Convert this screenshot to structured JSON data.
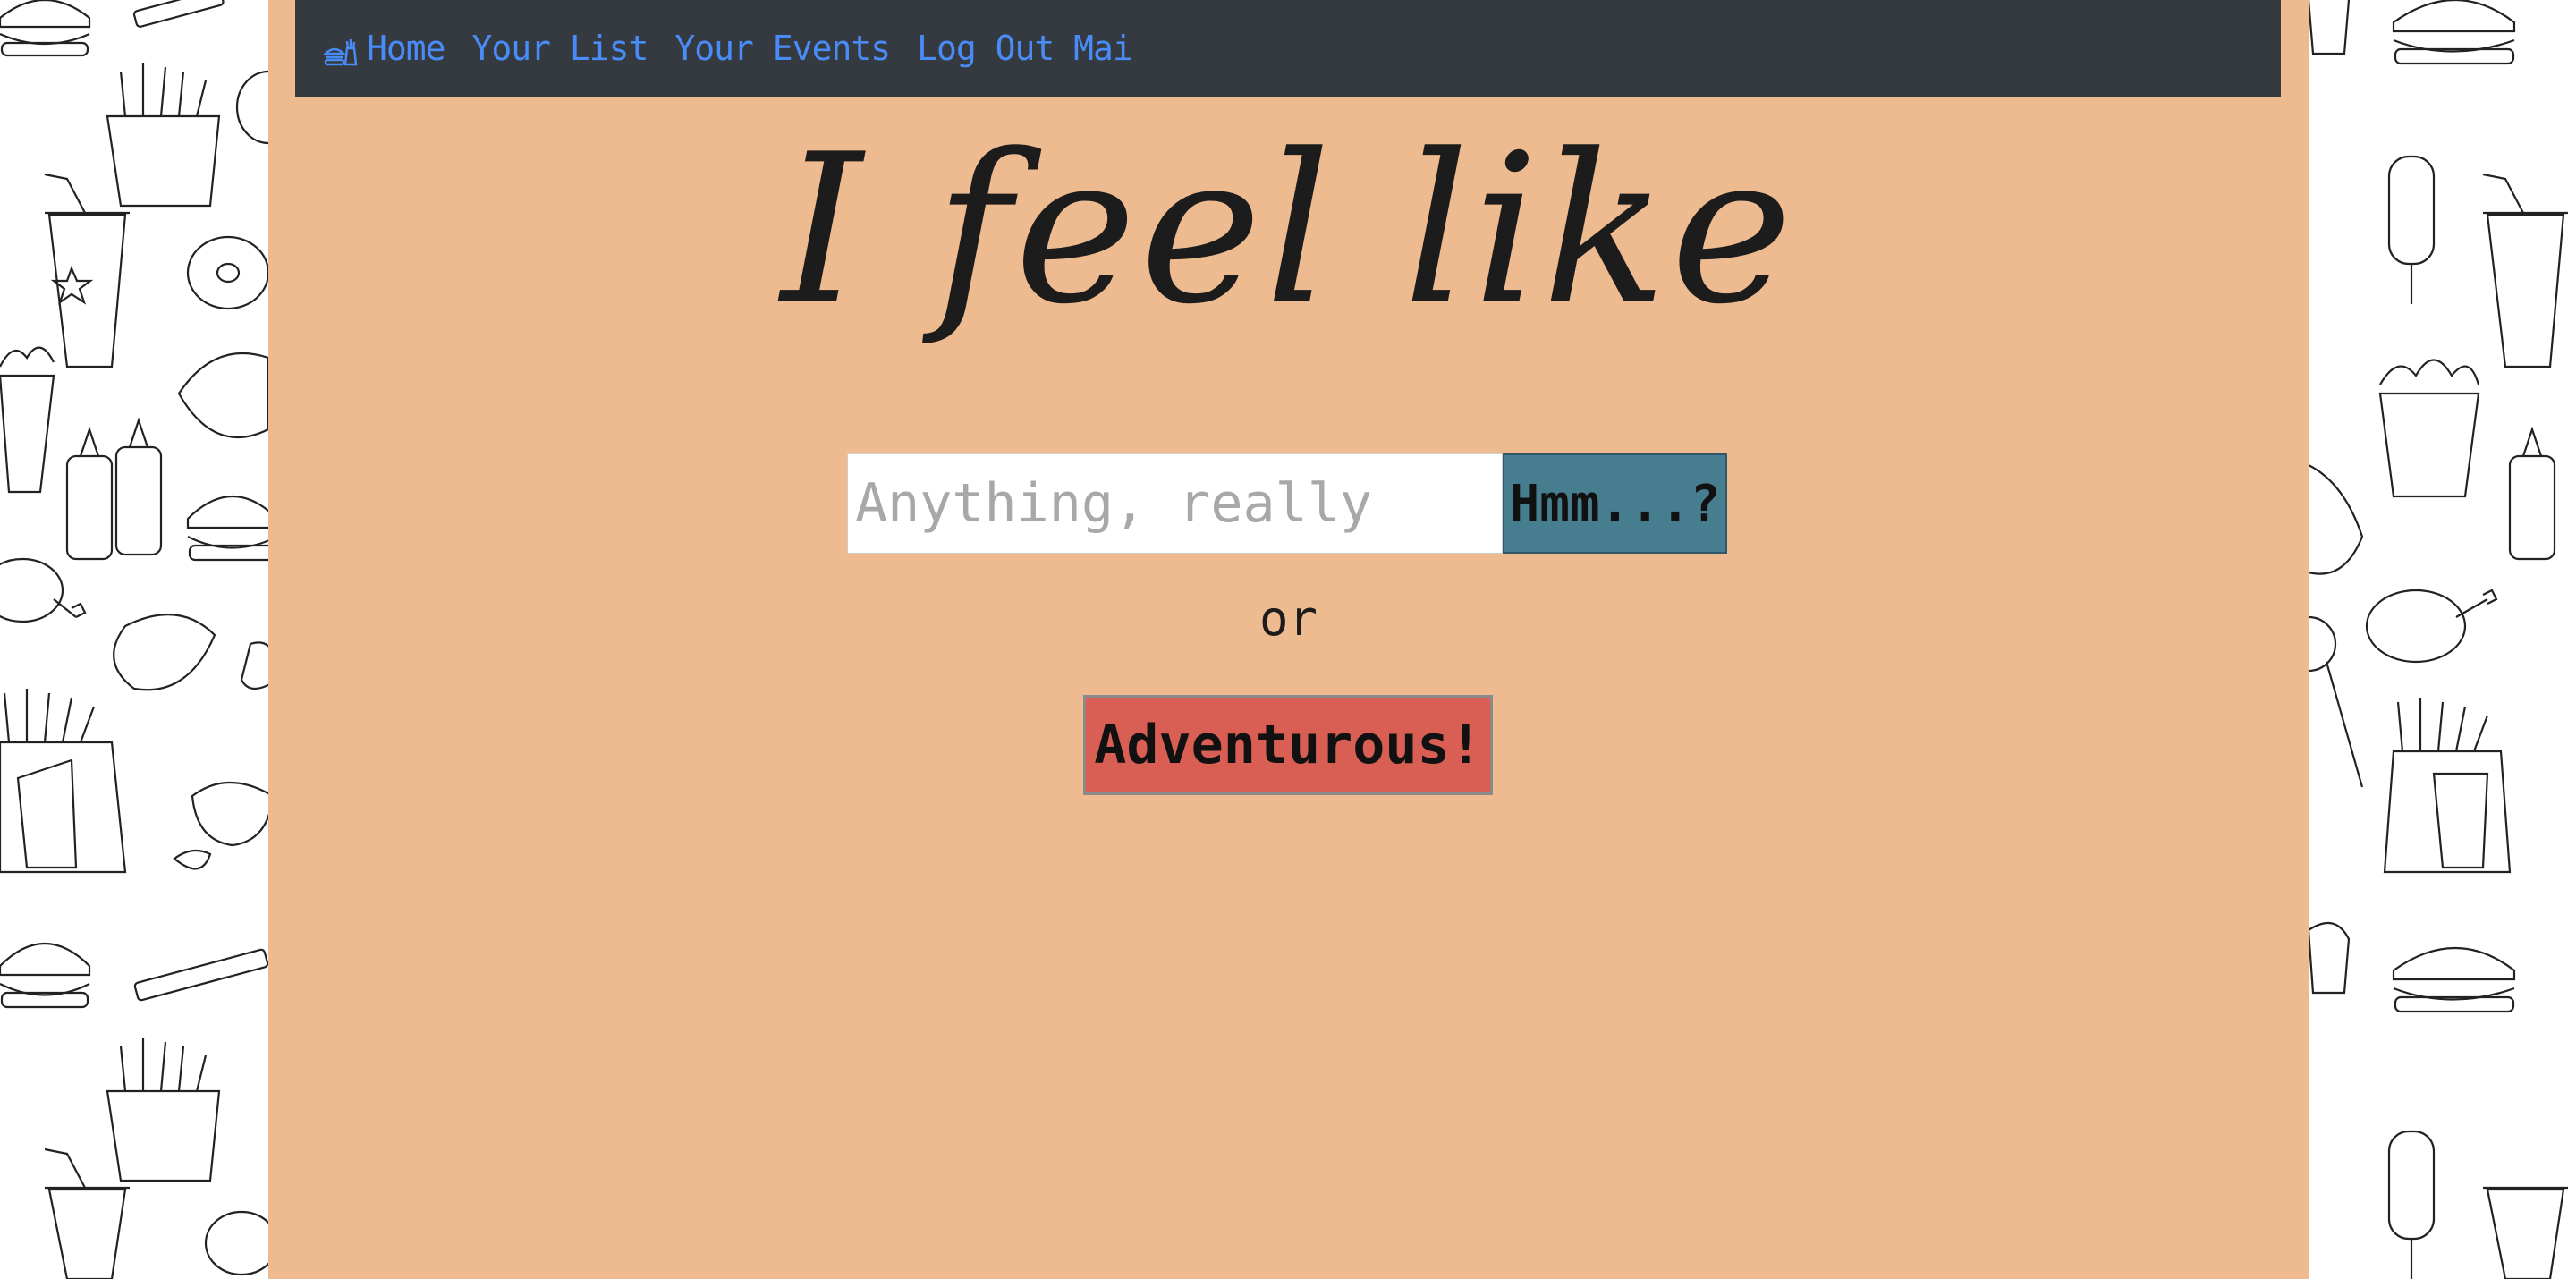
{
  "nav": {
    "brand_icon": "burger-fries-icon",
    "links": [
      {
        "label": "Home"
      },
      {
        "label": "Your List"
      },
      {
        "label": "Your Events"
      },
      {
        "label": "Log Out Mai"
      }
    ]
  },
  "heading": "I feel like",
  "search": {
    "placeholder": "Anything, really",
    "value": "",
    "button_label": "Hmm...?"
  },
  "or_text": "or",
  "adventure_button_label": "Adventurous!",
  "colors": {
    "panel": "#EEBA8F",
    "navbar": "#343A40",
    "nav_link": "#4A8CF7",
    "hmm_button": "#467E8F",
    "adventure_button": "#D95F55"
  },
  "background_pattern": "food-doodles"
}
